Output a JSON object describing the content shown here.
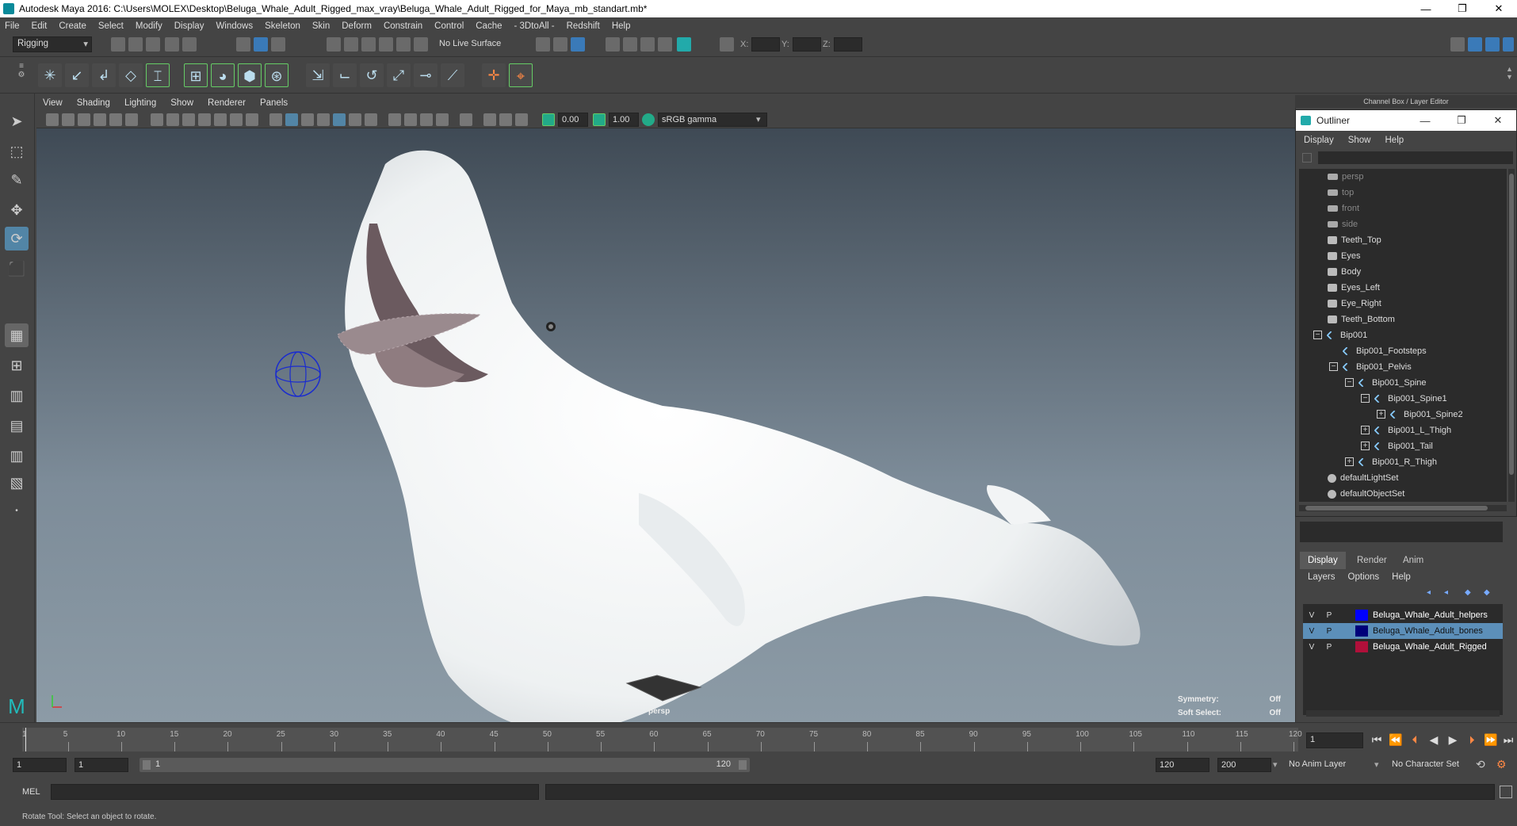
{
  "title": "Autodesk Maya 2016: C:\\Users\\MOLEX\\Desktop\\Beluga_Whale_Adult_Rigged_max_vray\\Beluga_Whale_Adult_Rigged_for_Maya_mb_standart.mb*",
  "window_controls": {
    "minimize": "—",
    "restore": "❐",
    "close": "✕"
  },
  "menubar": [
    "File",
    "Edit",
    "Create",
    "Select",
    "Modify",
    "Display",
    "Windows",
    "Skeleton",
    "Skin",
    "Deform",
    "Constrain",
    "Control",
    "Cache",
    "- 3DtoAll -",
    "Redshift",
    "Help"
  ],
  "status_line": {
    "menuset": "Rigging",
    "live_surface": "No Live Surface",
    "x_label": "X:",
    "y_label": "Y:",
    "z_label": "Z:"
  },
  "viewport": {
    "menu": [
      "View",
      "Shading",
      "Lighting",
      "Show",
      "Renderer",
      "Panels"
    ],
    "exposure": "0.00",
    "gamma": "1.00",
    "color_space": "sRGB gamma",
    "camera": "persp",
    "hud": {
      "symmetry_label": "Symmetry:",
      "symmetry_value": "Off",
      "soft_select_label": "Soft Select:",
      "soft_select_value": "Off"
    }
  },
  "channel_box_title": "Channel Box / Layer Editor",
  "outliner": {
    "title": "Outliner",
    "menu": [
      "Display",
      "Show",
      "Help"
    ],
    "items": [
      {
        "label": "persp",
        "type": "camera",
        "depth": 0
      },
      {
        "label": "top",
        "type": "camera",
        "depth": 0
      },
      {
        "label": "front",
        "type": "camera",
        "depth": 0
      },
      {
        "label": "side",
        "type": "camera",
        "depth": 0
      },
      {
        "label": "Teeth_Top",
        "type": "mesh",
        "depth": 0
      },
      {
        "label": "Eyes",
        "type": "mesh",
        "depth": 0
      },
      {
        "label": "Body",
        "type": "mesh",
        "depth": 0
      },
      {
        "label": "Eyes_Left",
        "type": "mesh",
        "depth": 0
      },
      {
        "label": "Eye_Right",
        "type": "mesh",
        "depth": 0
      },
      {
        "label": "Teeth_Bottom",
        "type": "mesh",
        "depth": 0
      },
      {
        "label": "Bip001",
        "type": "joint",
        "depth": 0,
        "expander": "−"
      },
      {
        "label": "Bip001_Footsteps",
        "type": "joint",
        "depth": 1
      },
      {
        "label": "Bip001_Pelvis",
        "type": "joint",
        "depth": 1,
        "expander": "−"
      },
      {
        "label": "Bip001_Spine",
        "type": "joint",
        "depth": 2,
        "expander": "−"
      },
      {
        "label": "Bip001_Spine1",
        "type": "joint",
        "depth": 3,
        "expander": "−"
      },
      {
        "label": "Bip001_Spine2",
        "type": "joint",
        "depth": 4,
        "expander": "+"
      },
      {
        "label": "Bip001_L_Thigh",
        "type": "joint",
        "depth": 3,
        "expander": "+"
      },
      {
        "label": "Bip001_Tail",
        "type": "joint",
        "depth": 3,
        "expander": "+"
      },
      {
        "label": "Bip001_R_Thigh",
        "type": "joint",
        "depth": 2,
        "expander": "+"
      },
      {
        "label": "defaultLightSet",
        "type": "set",
        "depth": 0
      },
      {
        "label": "defaultObjectSet",
        "type": "set",
        "depth": 0
      }
    ]
  },
  "layer_editor": {
    "tabs": [
      "Display",
      "Render",
      "Anim"
    ],
    "menu": [
      "Layers",
      "Options",
      "Help"
    ],
    "layers": [
      {
        "v": "V",
        "p": "P",
        "color": "#0000ff",
        "name": "Beluga_Whale_Adult_helpers",
        "selected": false
      },
      {
        "v": "V",
        "p": "P",
        "color": "#00007a",
        "name": "Beluga_Whale_Adult_bones",
        "selected": true
      },
      {
        "v": "V",
        "p": "P",
        "color": "#b0103a",
        "name": "Beluga_Whale_Adult_Rigged",
        "selected": false
      }
    ]
  },
  "timeline": {
    "ticks": [
      "5",
      "10",
      "15",
      "20",
      "25",
      "30",
      "35",
      "40",
      "45",
      "50",
      "55",
      "60",
      "65",
      "70",
      "75",
      "80",
      "85",
      "90",
      "95",
      "100",
      "105",
      "110",
      "115",
      "120"
    ],
    "start_tick": "1",
    "current_frame": "1"
  },
  "range": {
    "start": "1",
    "playback_start": "1",
    "slider_start": "1",
    "slider_end": "120",
    "playback_end": "120",
    "end": "200",
    "anim_layer": "No Anim Layer",
    "character_set": "No Character Set"
  },
  "command_line": {
    "label": "MEL"
  },
  "help_line": "Rotate Tool: Select an object to rotate.",
  "colors": {
    "accent": "#5285a6",
    "ui_bg": "#444444",
    "field_bg": "#2b2b2b"
  }
}
